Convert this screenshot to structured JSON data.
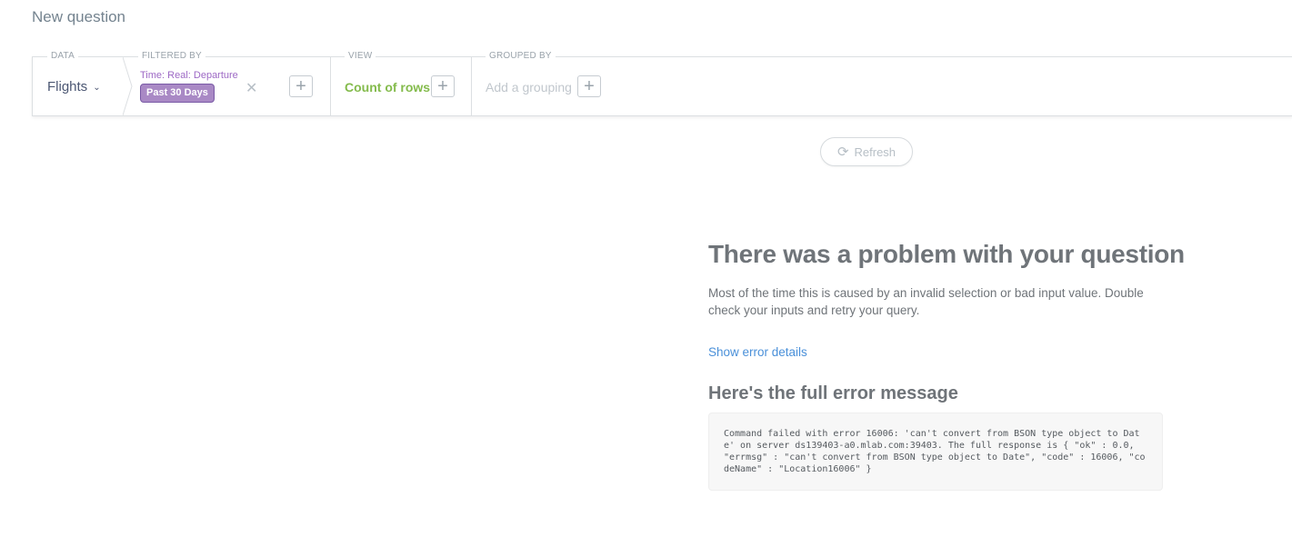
{
  "page": {
    "title": "New question"
  },
  "builder": {
    "data": {
      "label": "DATA",
      "value": "Flights"
    },
    "filter": {
      "label": "FILTERED BY",
      "caption": "Time: Real: Departure",
      "pill": "Past 30 Days",
      "remove_glyph": "✕",
      "add_glyph": "+"
    },
    "view": {
      "label": "VIEW",
      "value": "Count of rows",
      "add_glyph": "+"
    },
    "grouping": {
      "label": "GROUPED BY",
      "value": "Add a grouping",
      "add_glyph": "+"
    }
  },
  "refresh": {
    "label": "Refresh",
    "icon": "refresh-icon"
  },
  "error": {
    "title": "There was a problem with your question",
    "description": "Most of the time this is caused by an invalid selection or bad input value. Double check your inputs and retry your query.",
    "details_link": "Show error details",
    "full_title": "Here's the full error message",
    "message": "Command failed with error 16006: 'can't convert from BSON type object to Date' on server ds139403-a0.mlab.com:39403. The full response is { \"ok\" : 0.0, \"errmsg\" : \"can't convert from BSON type object to Date\", \"code\" : 16006, \"codeName\" : \"Location16006\" }"
  },
  "colors": {
    "filter_purple": "#a989c5",
    "view_green": "#84bb4c",
    "link_blue": "#4a90d9"
  }
}
